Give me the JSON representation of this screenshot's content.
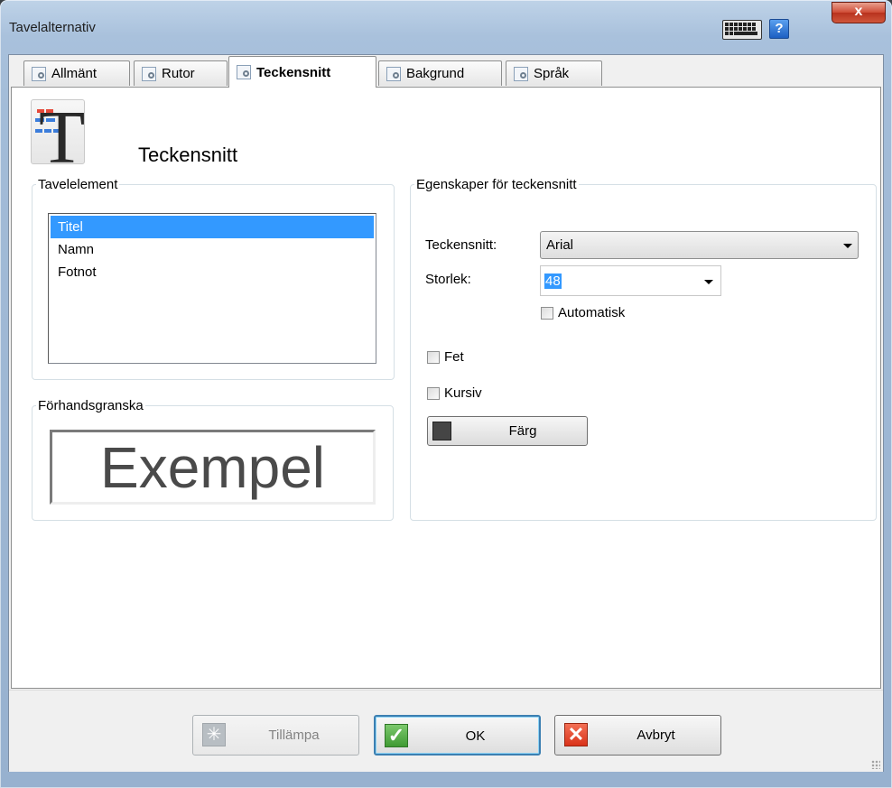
{
  "window": {
    "title": "Tavelalternativ",
    "close_glyph": "x",
    "help_glyph": "?"
  },
  "tabs": [
    {
      "label": "Allmänt",
      "icon": "gear-page-icon"
    },
    {
      "label": "Rutor",
      "icon": "gear-page-icon"
    },
    {
      "label": "Teckensnitt",
      "icon": "gear-page-icon",
      "active": true
    },
    {
      "label": "Bakgrund",
      "icon": "gear-page-icon"
    },
    {
      "label": "Språk",
      "icon": "gear-page-icon"
    }
  ],
  "header": {
    "icon_glyph": "T",
    "title": "Teckensnitt"
  },
  "elements_group": {
    "legend": "Tavelelement",
    "items": [
      "Titel",
      "Namn",
      "Fotnot"
    ],
    "selected": "Titel"
  },
  "preview_group": {
    "legend": "Förhandsgranska",
    "sample_text": "Exempel"
  },
  "font_group": {
    "legend": "Egenskaper för teckensnitt",
    "font_label": "Teckensnitt:",
    "font_value": "Arial",
    "size_label": "Storlek:",
    "size_value": "48",
    "auto_label": "Automatisk",
    "auto_checked": false,
    "bold_label": "Fet",
    "bold_checked": false,
    "italic_label": "Kursiv",
    "italic_checked": false,
    "color_button_label": "Färg",
    "color_value": "#454545"
  },
  "footer": {
    "apply_label": "Tillämpa",
    "ok_label": "OK",
    "cancel_label": "Avbryt",
    "ok_glyph": "✓",
    "cancel_glyph": "✕",
    "apply_glyph": "✳"
  }
}
